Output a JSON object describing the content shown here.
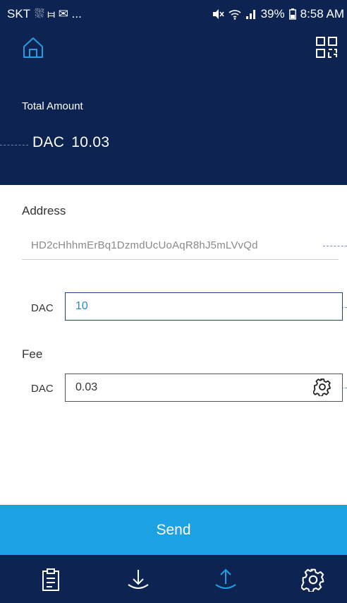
{
  "status_bar": {
    "carrier": "SKT",
    "notif_glyphs": "⛆ ⧦ ✉ ...",
    "battery": "39%",
    "time": "8:58 AM"
  },
  "summary": {
    "label": "Total Amount",
    "unit": "DAC",
    "value": "10.03"
  },
  "address": {
    "title": "Address",
    "value": "HD2cHhhmErBq1DzmdUcUoAqR8hJ5mLVvQd"
  },
  "amount": {
    "unit": "DAC",
    "value": "10"
  },
  "fee": {
    "title": "Fee",
    "unit": "DAC",
    "value": "0.03"
  },
  "send_label": "Send",
  "colors": {
    "header_bg": "#0d2453",
    "send_bg": "#1ca1e2",
    "active_tab": "#1ca1e2",
    "inactive_tab": "#ffffff",
    "amount_text": "#2b89c8"
  },
  "tabs": [
    {
      "icon": "clipboard-icon",
      "active": false
    },
    {
      "icon": "download-icon",
      "active": false
    },
    {
      "icon": "upload-icon",
      "active": true
    },
    {
      "icon": "gear-icon",
      "active": false
    }
  ]
}
